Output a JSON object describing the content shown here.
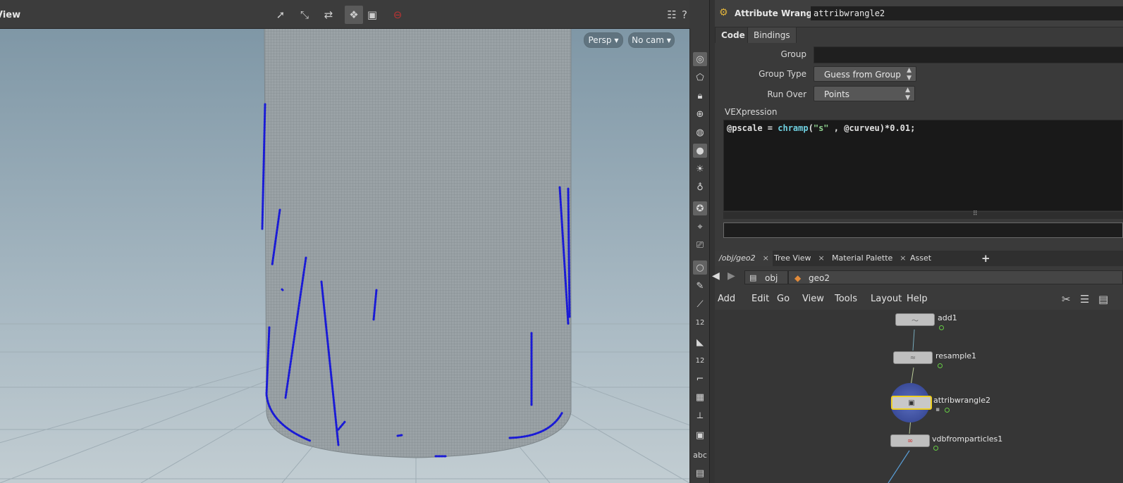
{
  "viewport": {
    "title": "View",
    "persp_label": "Persp",
    "cam_label": "No cam",
    "colors": {
      "sky_top": "#a9bcc6",
      "ground": "#b9c4ca",
      "points": "#1a1ad6",
      "cylinder": "#8a9296"
    },
    "tools": [
      "select-icon",
      "transform-icon",
      "handle-icon",
      "snap-icon",
      "display-icon",
      "no-entry-icon"
    ],
    "side_tools": [
      "display-options-icon",
      "geometry-icon",
      "lock-icon",
      "shading-icon",
      "xray-icon",
      "sphere-icon",
      "light-icon",
      "bulb-icon",
      "light-add-icon",
      "ghost-icon",
      "camera-icon",
      "render-icon",
      "point-icon",
      "brush-icon",
      "knife-icon",
      "number-icon",
      "eraser-icon",
      "number-icon",
      "curve-icon",
      "grid-icon",
      "measure-icon",
      "stop-icon",
      "text-icon",
      "info-icon"
    ],
    "side_labels": {
      "num1": "12",
      "num2": "12",
      "abc": "abc"
    }
  },
  "params": {
    "node_type": "Attribute Wrangle",
    "node_name": "attribwrangle2",
    "tabs": [
      "Code",
      "Bindings"
    ],
    "group_label": "Group",
    "group_value": "",
    "group_type_label": "Group Type",
    "group_type_value": "Guess from Group",
    "run_over_label": "Run Over",
    "run_over_value": "Points",
    "vex_label": "VEXpression",
    "code": {
      "p1": "@pscale = ",
      "fn": "chramp",
      "p2": "(",
      "str": "\"s\"",
      "p3": " , @curveu)*0.01;"
    }
  },
  "network": {
    "tabs": [
      "/obj/geo2",
      "Tree View",
      "Material Palette",
      "Asset Browser"
    ],
    "add_tab": "+",
    "close": "×",
    "crumbs": [
      "obj",
      "geo2"
    ],
    "menus": [
      "Add",
      "Edit",
      "Go",
      "View",
      "Tools",
      "Layout",
      "Help"
    ],
    "nodes": [
      {
        "name": "add1",
        "glyph": "〜"
      },
      {
        "name": "resample1",
        "glyph": "≈"
      },
      {
        "name": "attribwrangle2",
        "glyph": "▣"
      },
      {
        "name": "vdbfromparticles1",
        "glyph": "∞"
      }
    ]
  }
}
